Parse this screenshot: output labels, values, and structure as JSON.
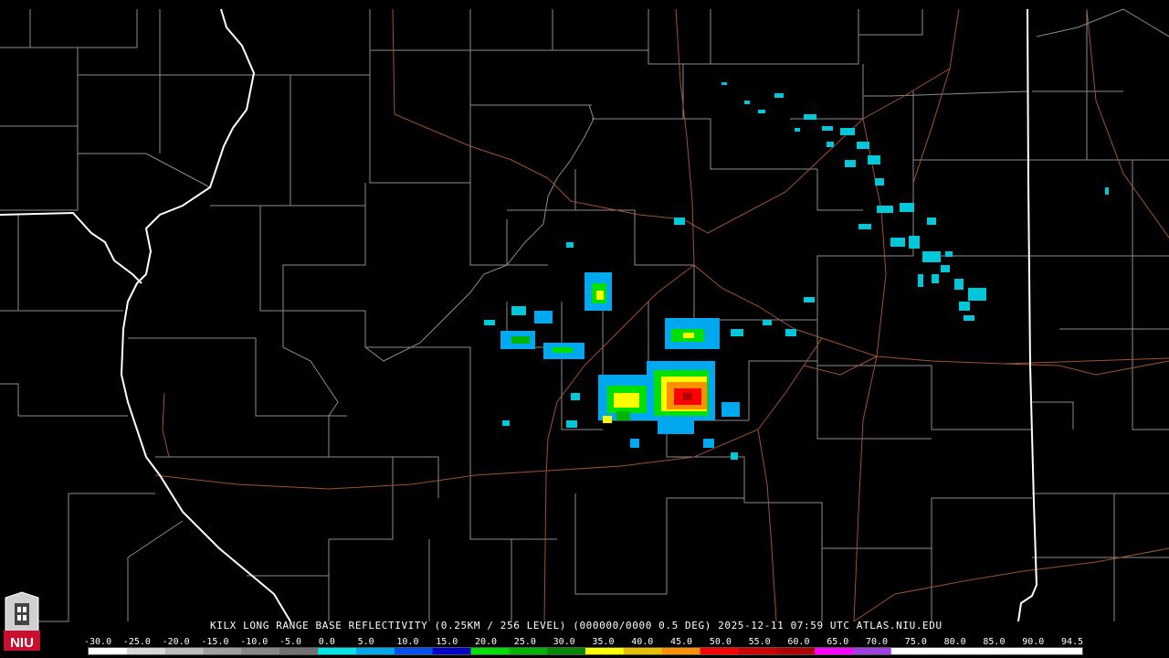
{
  "header": {
    "title": "KILX LONG RANGE BASE REFLECTIVITY (0.25KM / 256 LEVEL) (000000/0000 0.5 DEG) 2025-12-11 07:59 UTC  ATLAS.NIU.EDU"
  },
  "logo": {
    "text": "NIU",
    "icon": "niu-tower-icon"
  },
  "colors": {
    "background": "#000000",
    "county_lines": "#8c8c8c",
    "state_lines": "#ffffff",
    "highways": "#a0522d"
  },
  "scale": {
    "labels": [
      "-30.0",
      "-25.0",
      "-20.0",
      "-15.0",
      "-10.0",
      "-5.0",
      "0.0",
      "5.0",
      "10.0",
      "15.0",
      "20.0",
      "25.0",
      "30.0",
      "35.0",
      "40.0",
      "45.0",
      "50.0",
      "55.0",
      "60.0",
      "65.0",
      "70.0",
      "75.0",
      "80.0",
      "85.0",
      "90.0",
      "94.5"
    ],
    "colors": [
      "#ffffff",
      "#d8d8d8",
      "#bcbcbc",
      "#a0a0a0",
      "#888888",
      "#707070",
      "#00e5e5",
      "#00a8f0",
      "#0050f0",
      "#0000c8",
      "#00e000",
      "#00b400",
      "#008800",
      "#ffff00",
      "#e8c000",
      "#ff9000",
      "#ff0000",
      "#d00000",
      "#b00000",
      "#ff00ff",
      "#a040e0",
      "#ffffff",
      "#ffffff",
      "#ffffff",
      "#ffffff",
      "#ffffff"
    ]
  }
}
